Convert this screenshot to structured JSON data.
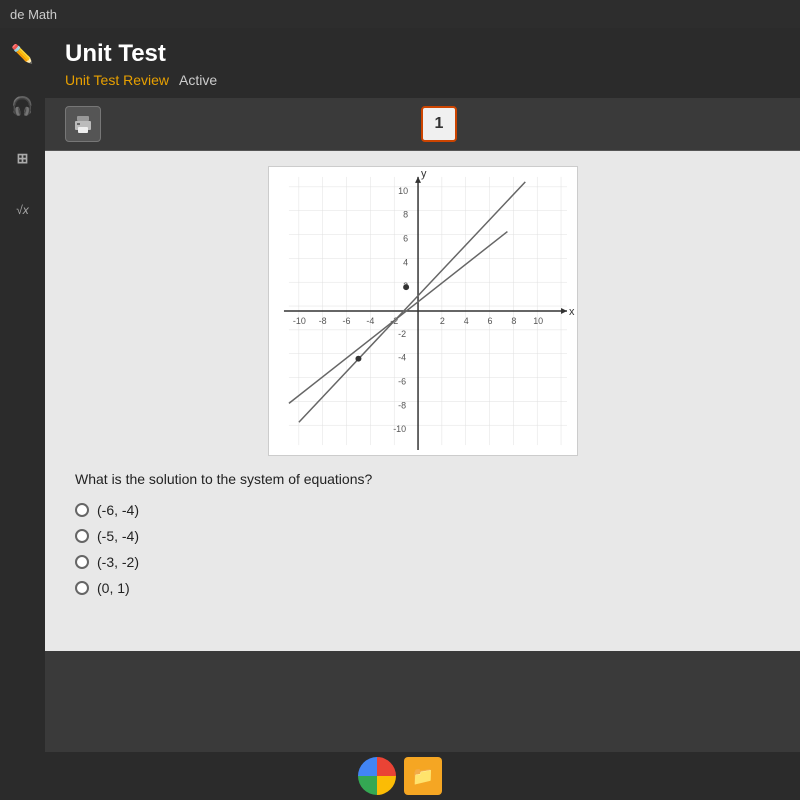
{
  "topbar": {
    "title": "de Math"
  },
  "header": {
    "title": "Unit Test",
    "breadcrumb_link": "Unit Test Review",
    "breadcrumb_status": "Active"
  },
  "toolbar": {
    "print_label": "print",
    "question_number": "1"
  },
  "question": {
    "text": "What is the solution to the system of equations?",
    "options": [
      "(-6, -4)",
      "(-5, -4)",
      "(-3, -2)",
      "(0, 1)"
    ]
  },
  "sidebar": {
    "icons": [
      {
        "name": "edit-icon",
        "symbol": "✏️"
      },
      {
        "name": "headphone-icon",
        "symbol": "🎧"
      },
      {
        "name": "calculator-icon",
        "symbol": "⊞"
      },
      {
        "name": "sqrt-icon",
        "symbol": "√x"
      }
    ]
  },
  "taskbar": {
    "icons": [
      {
        "name": "chrome-icon",
        "symbol": "⊙"
      },
      {
        "name": "files-icon",
        "symbol": "📁"
      }
    ]
  },
  "graph": {
    "x_label": "x",
    "y_label": "y",
    "x_axis_labels": [
      "-10",
      "-8",
      "-6",
      "-4",
      "-2",
      "2",
      "4",
      "6",
      "8",
      "10"
    ],
    "y_axis_labels": [
      "-10",
      "-8",
      "-6",
      "-4",
      "-2",
      "2",
      "4",
      "6",
      "8",
      "10"
    ]
  }
}
